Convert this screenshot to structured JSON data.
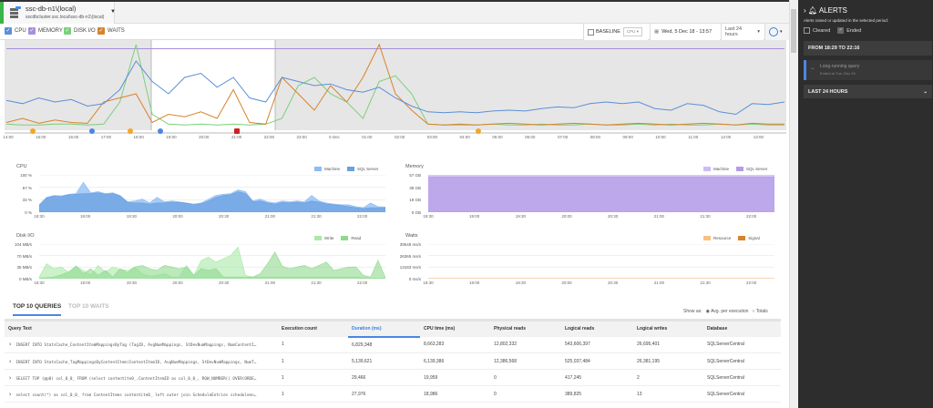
{
  "server": {
    "name": "ssc-db-n1\\(local)",
    "path": "sscdbcluster.ssc.local\\ssc-db-n1\\(local)"
  },
  "legend": [
    {
      "label": "CPU",
      "color": "#5b8fd8"
    },
    {
      "label": "MEMORY",
      "color": "#a88fdc"
    },
    {
      "label": "DISK I/O",
      "color": "#7ccf7c"
    },
    {
      "label": "WAITS",
      "color": "#d9822b"
    }
  ],
  "controls": {
    "baseline": "BASELINE",
    "baseline_metric": "CPU",
    "date": "Wed, 5 Dec 18 - 13:57",
    "range": "Last 24 hours"
  },
  "overview": {
    "ticks": [
      "14:00",
      "15:00",
      "16:00",
      "17:00",
      "18:00",
      "19:00",
      "20:00",
      "21:00",
      "22:00",
      "23:00",
      "5 Dec",
      "01:00",
      "02:00",
      "03:00",
      "04:00",
      "05:00",
      "06:00",
      "07:00",
      "08:00",
      "09:00",
      "10:00",
      "11:00",
      "12:00",
      "13:00"
    ],
    "cpu": [
      32,
      28,
      35,
      30,
      33,
      25,
      28,
      45,
      80,
      55,
      40,
      60,
      65,
      48,
      60,
      35,
      30,
      60,
      55,
      50,
      52,
      45,
      42,
      48,
      35,
      25,
      18,
      17,
      18,
      17,
      19,
      20,
      19,
      22,
      24,
      23,
      28,
      30,
      28,
      30,
      22,
      20,
      28,
      26,
      18,
      15,
      28,
      27,
      30
    ],
    "memory": [
      95,
      95,
      95,
      95,
      95,
      95,
      95,
      95,
      95,
      95,
      95,
      95,
      95,
      95,
      95,
      95,
      95,
      95,
      95,
      95,
      95,
      95,
      95,
      95,
      95,
      95,
      95,
      95,
      95,
      95,
      95,
      95,
      95,
      95,
      95,
      95,
      95,
      95,
      95,
      95,
      95,
      95,
      95,
      95,
      95,
      95,
      95,
      95,
      95
    ],
    "disk": [
      3,
      2,
      2,
      3,
      3,
      2,
      3,
      30,
      100,
      15,
      3,
      2,
      3,
      2,
      3,
      2,
      3,
      10,
      50,
      60,
      40,
      30,
      10,
      55,
      62,
      40,
      3,
      2,
      2,
      2,
      3,
      2,
      2,
      3,
      2,
      2,
      3,
      2,
      2,
      3,
      2,
      3,
      2,
      2,
      3,
      2,
      3,
      2,
      2
    ],
    "waits": [
      5,
      10,
      4,
      8,
      5,
      4,
      30,
      35,
      40,
      5,
      15,
      12,
      18,
      10,
      45,
      5,
      3,
      60,
      40,
      20,
      50,
      30,
      60,
      100,
      40,
      20,
      3,
      2,
      3,
      2,
      3,
      4,
      3,
      2,
      3,
      4,
      3,
      2,
      3,
      4,
      3,
      2,
      3,
      4,
      3,
      2,
      4,
      3,
      3
    ],
    "markers": [
      {
        "time": "14:45",
        "color": "#f5a623"
      },
      {
        "time": "16:35",
        "color": "#4a86e8"
      },
      {
        "time": "17:45",
        "color": "#f5a623"
      },
      {
        "time": "18:40",
        "color": "#4a86e8"
      },
      {
        "time": "21:00",
        "color": "#cc2222"
      },
      {
        "time": "04:25",
        "color": "#f5a623"
      }
    ]
  },
  "charts": {
    "xticks": [
      "18:30",
      "19:00",
      "19:30",
      "20:00",
      "20:30",
      "21:00",
      "21:30",
      "22:00"
    ],
    "cpu": {
      "title": "CPU",
      "yticks": [
        "100 %",
        "67 %",
        "33 %",
        "0 %"
      ],
      "series": [
        {
          "name": "Machine",
          "color": "#8bbcf5",
          "values": [
            20,
            40,
            45,
            44,
            48,
            50,
            80,
            52,
            55,
            50,
            52,
            45,
            28,
            30,
            35,
            25,
            40,
            28,
            30,
            28,
            25,
            22,
            25,
            35,
            45,
            48,
            50,
            60,
            55,
            30,
            35,
            28,
            25,
            30,
            28,
            30,
            28,
            45,
            30,
            25,
            22,
            20,
            20,
            15,
            12,
            25,
            15,
            14
          ]
        },
        {
          "name": "SQL Server",
          "color": "#6a9fe0",
          "values": [
            18,
            38,
            43,
            42,
            46,
            48,
            50,
            50,
            52,
            48,
            50,
            43,
            26,
            25,
            25,
            22,
            25,
            25,
            27,
            26,
            24,
            20,
            23,
            30,
            40,
            45,
            47,
            55,
            50,
            28,
            30,
            25,
            22,
            26,
            25,
            27,
            25,
            30,
            27,
            22,
            20,
            18,
            15,
            12,
            10,
            12,
            12,
            12
          ]
        }
      ]
    },
    "memory": {
      "title": "Memory",
      "yticks": [
        "57 GB",
        "38 GB",
        "19 GB",
        "0 GB"
      ],
      "series": [
        {
          "name": "Machine",
          "color": "#cdbcf5",
          "values": [
            57,
            57,
            57,
            57,
            57,
            57,
            57,
            57,
            57,
            57,
            57,
            57,
            57,
            57,
            57,
            57
          ]
        },
        {
          "name": "SQL Server",
          "color": "#b49be8",
          "values": [
            54,
            54,
            54,
            54,
            54,
            54,
            54,
            54,
            54,
            54,
            54,
            54,
            54,
            54,
            54,
            54
          ]
        }
      ]
    },
    "disk": {
      "title": "Disk I/O",
      "yticks": [
        "104 MB/s",
        "70 MB/s",
        "35 MB/s",
        "0 MB/s"
      ],
      "series": [
        {
          "name": "Write",
          "color": "#a8eaa8",
          "values": [
            5,
            45,
            30,
            35,
            20,
            38,
            25,
            10,
            40,
            20,
            35,
            28,
            25,
            35,
            15,
            8,
            10,
            15,
            5,
            5,
            40,
            10,
            55,
            65,
            50,
            60,
            70,
            95,
            10,
            5,
            5,
            5,
            5,
            5,
            5,
            5,
            5,
            5,
            5,
            5,
            5,
            5,
            5,
            5,
            3,
            2,
            2,
            2
          ]
        },
        {
          "name": "Read",
          "color": "#8fd98f",
          "values": [
            2,
            3,
            5,
            12,
            20,
            38,
            15,
            30,
            10,
            25,
            5,
            30,
            18,
            35,
            40,
            30,
            25,
            40,
            35,
            30,
            35,
            10,
            30,
            25,
            30,
            5,
            5,
            5,
            5,
            5,
            15,
            45,
            80,
            38,
            30,
            35,
            40,
            30,
            40,
            50,
            25,
            30,
            35,
            35,
            10,
            5,
            55,
            3
          ]
        }
      ]
    },
    "waits": {
      "title": "Waits",
      "yticks": [
        "39548 ms/s",
        "26365 ms/s",
        "13183 ms/s",
        "0 ms/s"
      ],
      "series": [
        {
          "name": "Resource",
          "color": "#fbbf80",
          "values": [
            2,
            5,
            10,
            8,
            12,
            3,
            2,
            3,
            2,
            3,
            10,
            2,
            3,
            38,
            22,
            22,
            20,
            2,
            3,
            25,
            15,
            20,
            8,
            5,
            18,
            12,
            20,
            8,
            25,
            10,
            5,
            18,
            8,
            5,
            2,
            8,
            38,
            3,
            25,
            18,
            12,
            15,
            8,
            12,
            22,
            30,
            2,
            1
          ]
        },
        {
          "name": "Signal",
          "color": "#d9822b",
          "values": [
            1,
            1,
            1,
            1,
            1,
            1,
            1,
            1,
            1,
            2,
            2,
            2,
            2,
            2,
            2,
            2,
            1,
            1,
            1,
            1,
            1,
            1,
            1,
            1,
            1,
            1,
            1,
            1,
            1,
            1,
            1,
            1,
            1,
            1,
            1,
            1,
            1,
            1,
            1,
            1,
            1,
            1,
            1,
            1,
            1,
            1,
            1,
            1
          ]
        }
      ]
    }
  },
  "tabs": [
    "TOP 10 QUERIES",
    "TOP 10 WAITS"
  ],
  "show_as": {
    "label": "Show as:",
    "options": [
      "Avg. per execution",
      "Totals"
    ]
  },
  "table": {
    "headers": [
      "Query Text",
      "Execution count",
      "Duration (ms)",
      "CPU time (ms)",
      "Physical reads",
      "Logical reads",
      "Logical writes",
      "Database"
    ],
    "rows": [
      [
        "INSERT INTO StatsCache_ContentItemMappingsByTag (TagID, AvgNumMappings, StDevNumMappings, NumContentI…",
        "1",
        "6,829,348",
        "8,663,283",
        "12,802,332",
        "543,606,397",
        "26,695,401",
        "SQLServerCentral"
      ],
      [
        "INSERT INTO StatsCache_TagMappingsByContentItem(ContentItemID, AvgNumMappings, StDevNumMappings, NumT…",
        "1",
        "5,139,621",
        "6,139,386",
        "12,386,568",
        "525,037,484",
        "26,381,195",
        "SQLServerCentral"
      ],
      [
        "SELECT TOP (@p0) col_0_0_ FROM (select contentite0_.ContentItemID as col_0_0_, ROW_NUMBER() OVER(ORDE…",
        "1",
        "29,466",
        "19,959",
        "0",
        "417,245",
        "2",
        "SQLServerCentral"
      ],
      [
        "select count(*) as col_0_0_ from ContentItems contentite0_ left outer join ScheduleEntries scheduleen…",
        "1",
        "27,976",
        "18,986",
        "0",
        "389,825",
        "13",
        "SQLServerCentral"
      ]
    ]
  },
  "alerts": {
    "title": "ALERTS",
    "subtitle": "Alerts raised or updated in the selected period:",
    "cleared": "Cleared",
    "ended": "Ended",
    "period": "FROM 18:29 TO 22:16",
    "item": {
      "title": "Long-running query",
      "detail": "Ended at Tue, Dec 04",
      "color": "#4a86e8"
    },
    "range": "LAST 24 HOURS"
  }
}
